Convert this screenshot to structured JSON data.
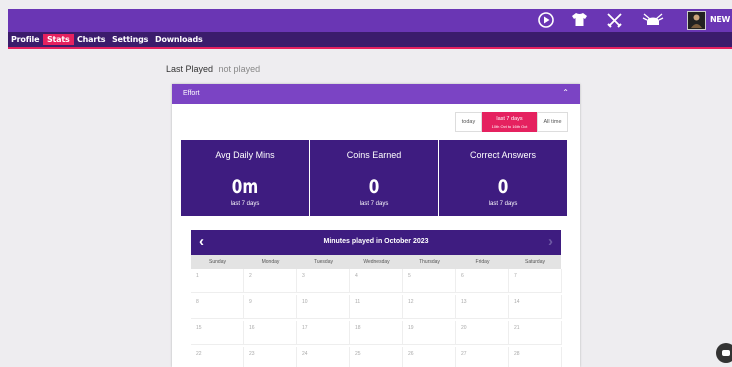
{
  "topbar": {
    "icons": [
      "play-circle-icon",
      "shirt-icon",
      "crossed-swords-icon",
      "drum-icon"
    ],
    "user_name": "NEW ARTI"
  },
  "nav": {
    "items": [
      {
        "label": "Profile",
        "active": false
      },
      {
        "label": "Stats",
        "active": true
      },
      {
        "label": "Charts",
        "active": false
      },
      {
        "label": "Settings",
        "active": false
      },
      {
        "label": "Downloads",
        "active": false
      }
    ]
  },
  "last_played": {
    "label": "Last Played",
    "value": "not played"
  },
  "panel": {
    "title": "Effort",
    "ranges": {
      "today": "today",
      "last7": "last 7 days",
      "last7_sub": "10th Oct to 16th Oct",
      "all": "All time"
    },
    "stats": [
      {
        "title": "Avg Daily Mins",
        "value": "0m",
        "sub": "last 7 days"
      },
      {
        "title": "Coins Earned",
        "value": "0",
        "sub": "last 7 days"
      },
      {
        "title": "Correct Answers",
        "value": "0",
        "sub": "last 7 days"
      }
    ],
    "calendar": {
      "title": "Minutes played in October 2023",
      "days": [
        "Sunday",
        "Monday",
        "Tuesday",
        "Wednesday",
        "Thursday",
        "Friday",
        "Saturday"
      ],
      "weeks": [
        [
          "1",
          "2",
          "3",
          "4",
          "5",
          "6",
          "7"
        ],
        [
          "8",
          "9",
          "10",
          "11",
          "12",
          "13",
          "14"
        ],
        [
          "15",
          "16",
          "17",
          "18",
          "19",
          "20",
          "21"
        ],
        [
          "22",
          "23",
          "24",
          "25",
          "26",
          "27",
          "28"
        ]
      ]
    }
  },
  "colors": {
    "topbar": "#6a36b4",
    "navbar": "#3b1c6c",
    "accent": "#e5215f",
    "card": "#3e1c80",
    "panel_header": "#7b44c4"
  }
}
